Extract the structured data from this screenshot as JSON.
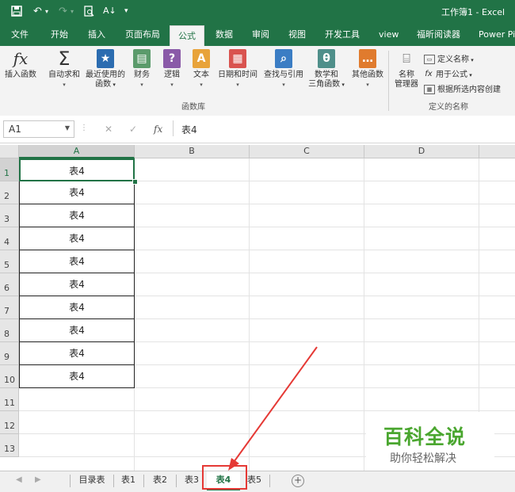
{
  "titlebar": {
    "save_icon": "save-icon",
    "undo_icon": "undo-icon",
    "redo_icon": "redo-icon",
    "print_preview_icon": "print-preview-icon",
    "sort_icon": "sort-icon",
    "customize_icon": "customize-icon",
    "title": "工作簿1 - Excel"
  },
  "tabs": [
    "文件",
    "开始",
    "插入",
    "页面布局",
    "公式",
    "数据",
    "审阅",
    "视图",
    "开发工具",
    "view",
    "福昕阅读器",
    "Power Pi"
  ],
  "active_tab": "公式",
  "ribbon": {
    "insert_function": "插入函数",
    "autosum": "自动求和",
    "recent_1": "最近使用的",
    "recent_2": "函数",
    "financial": "财务",
    "logical": "逻辑",
    "text": "文本",
    "datetime": "日期和时间",
    "lookup": "查找与引用",
    "math_1": "数学和",
    "math_2": "三角函数",
    "more": "其他函数",
    "group_library": "函数库",
    "name_manager_1": "名称",
    "name_manager_2": "管理器",
    "define_name": "定义名称",
    "use_in_formula": "用于公式",
    "create_from_selection": "根据所选内容创建",
    "group_names": "定义的名称"
  },
  "formula_bar": {
    "name_box": "A1",
    "cancel": "✕",
    "enter": "✓",
    "fx": "fx",
    "content": "表4"
  },
  "columns": [
    "A",
    "B",
    "C",
    "D"
  ],
  "rows": [
    "1",
    "2",
    "3",
    "4",
    "5",
    "6",
    "7",
    "8",
    "9",
    "10",
    "11",
    "12",
    "13"
  ],
  "cells_A": [
    "表4",
    "表4",
    "表4",
    "表4",
    "表4",
    "表4",
    "表4",
    "表4",
    "表4",
    "表4"
  ],
  "sheets": [
    "目录表",
    "表1",
    "表2",
    "表3",
    "表4",
    "表5"
  ],
  "active_sheet": "表4",
  "add_sheet": "+",
  "watermark": {
    "line1": "百科全说",
    "line2": "助你轻松解决"
  },
  "colors": {
    "excel_green": "#217346",
    "annotation_red": "#e53935",
    "watermark_green": "#4aa62f"
  }
}
